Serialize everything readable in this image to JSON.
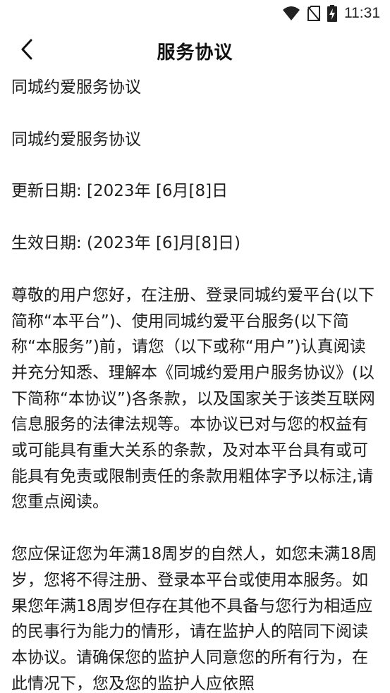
{
  "status_bar": {
    "time": "11:31",
    "icons": [
      "wifi-icon",
      "no-sim-icon",
      "battery-charging-icon"
    ]
  },
  "header": {
    "back_icon": "chevron-left-icon",
    "title": "服务协议"
  },
  "content": {
    "paragraphs": [
      "同城约爱服务协议",
      "同城约爱服务协议",
      "更新日期: [2023年 [6月[8]日",
      "生效日期: (2023年  [6]月[8]日)",
      "尊敬的用户您好，在注册、登录同城约爱平台(以下简称“本平台”)、使用同城约爱平台服务(以下简称“本服务”)前，请您（以下或称“用户”)认真阅读并充分知悉、理解本《同城约爱用户服务协议》(以下简称“本协议”)各条款，以及国家关于该类互联网信息服务的法律法规等。本协议已对与您的权益有或可能具有重大关系的条款，及对本平台具有或可能具有免责或限制责任的条款用粗体字予以标注,请您重点阅读。",
      "您应保证您为年满18周岁的自然人，如您未满18周岁，您将不得注册、登录本平台或使用本服务。如果您年满18周岁但存在其他不具备与您行为相适应的民事行为能力的情形，请在监护人的陪同下阅读本协议。请确保您的监护人同意您的所有行为，在此情况下，您及您的监护人应依照"
    ]
  }
}
